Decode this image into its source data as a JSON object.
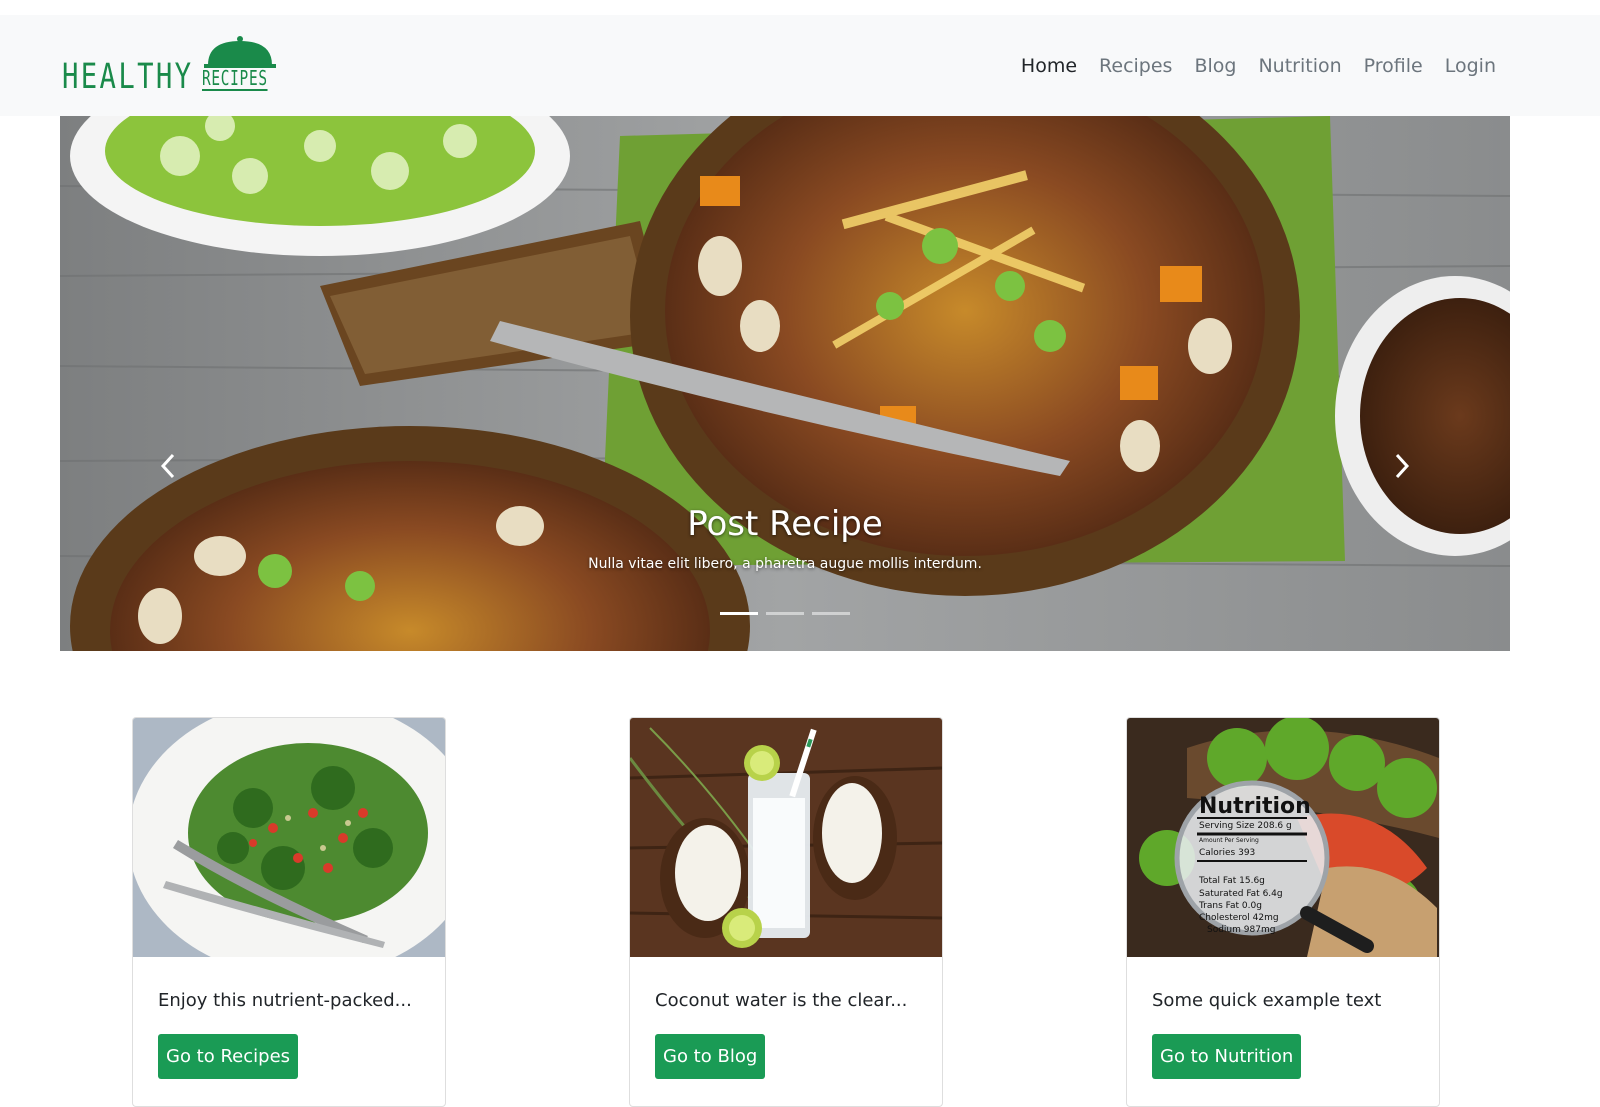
{
  "brand": {
    "name": "HEALTHY",
    "sub": "RECIPES",
    "color": "#1a8a4a"
  },
  "nav": {
    "items": [
      {
        "label": "Home",
        "active": true
      },
      {
        "label": "Recipes",
        "active": false
      },
      {
        "label": "Blog",
        "active": false
      },
      {
        "label": "Nutrition",
        "active": false
      },
      {
        "label": "Profile",
        "active": false
      },
      {
        "label": "Login",
        "active": false
      }
    ]
  },
  "carousel": {
    "title": "Post Recipe",
    "text": "Nulla vitae elit libero, a pharetra augue mollis interdum.",
    "prev_icon": "chevron-left-icon",
    "next_icon": "chevron-right-icon",
    "indicator_count": 3,
    "active_index": 0
  },
  "cards": [
    {
      "text": "Enjoy this nutrient-packed...",
      "button": "Go to Recipes",
      "image": "salad"
    },
    {
      "text": "Coconut water is the clear...",
      "button": "Go to Blog",
      "image": "coconut"
    },
    {
      "text": "Some quick example text",
      "button": "Go to Nutrition",
      "image": "nutrition"
    }
  ],
  "nutrition_label": {
    "heading": "Nutrition",
    "lines": [
      "Serving Size 208.6 g",
      "Amount Per Serving",
      "Calories 393",
      "Total Fat 15.6g",
      "Saturated Fat 6.4g",
      "Trans Fat 0.0g",
      "Cholesterol 42mg",
      "Sodium 987mg"
    ]
  },
  "theme": {
    "accent": "#1a9b55",
    "navbar_bg": "#f8f9fa"
  }
}
